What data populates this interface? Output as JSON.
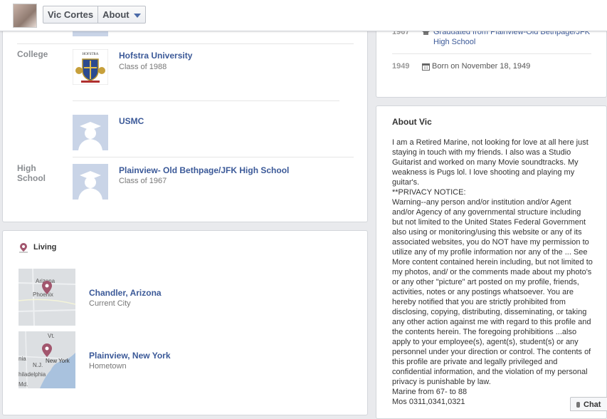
{
  "header": {
    "name": "Vic Cortes",
    "about_label": "About"
  },
  "education": {
    "college_label": "College",
    "high_school_label": "High\nSchool",
    "items": [
      {
        "name": "Hofstra University",
        "sub": "Class of 1988",
        "logo_text": "HOFSTRA"
      },
      {
        "name": "USMC",
        "sub": ""
      },
      {
        "name": "Plainview- Old Bethpage/JFK High School",
        "sub": "Class of 1967"
      }
    ]
  },
  "living": {
    "title": "Living",
    "places": [
      {
        "name": "Chandler, Arizona",
        "sub": "Current City",
        "map_labels": [
          "Arizona",
          "Phoenix"
        ]
      },
      {
        "name": "Plainview, New York",
        "sub": "Hometown",
        "map_labels": [
          "Vt.",
          "New York",
          "nia",
          "N.J.",
          "hiladelphia",
          "Md."
        ]
      }
    ]
  },
  "life_events": [
    {
      "year": "1967",
      "text": "Graduated from Plainview-Old Bethpage/JFK High School"
    },
    {
      "year": "1949",
      "text": "Born on November 18, 1949"
    }
  ],
  "about": {
    "title": "About Vic",
    "text": "I am a Retired Marine, not looking for love at all here just staying in touch with my friends. I also was a Studio Guitarist and worked on many Movie soundtracks. My weakness is Pugs lol. I love shooting and playing my guitar's.\n**PRIVACY NOTICE:\nWarning--any person and/or institution and/or Agent and/or Agency of any governmental structure including but not limited to the United States Federal Government also using or monitoring/using this website or any of its associated websites, you do NOT have my permission to utilize any of my profile information nor any of the ... See More content contained herein including, but not limited to my photos, and/ or the comments made about my photo's or any other \"picture\" art posted on my profile, friends, activities, notes or any postings whatsoever. You are hereby notified that you are strictly prohibited from disclosing, copying, distributing, disseminating, or taking any other action against me with regard to this profile and the contents herein. The foregoing prohibitions ...also apply to your employee(s), agent(s), student(s) or any personnel under your direction or control. The contents of this profile are private and legally privileged and confidential information, and the violation of my personal privacy is punishable by law.\nMarine from 67- to 88\nMos 0311,0341,0321"
  },
  "chat": {
    "label": "Chat"
  },
  "colors": {
    "link": "#3b5998",
    "page_bg": "#e9eaed",
    "map_pin": "#a2566e"
  }
}
